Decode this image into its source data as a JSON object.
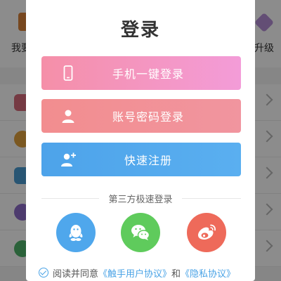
{
  "background": {
    "top_left_label": "我要",
    "top_right_label": "升级"
  },
  "dialog": {
    "title": "登录",
    "buttons": {
      "phone": "手机一键登录",
      "account": "账号密码登录",
      "register": "快速注册"
    },
    "third_party_title": "第三方极速登录",
    "social_icons": [
      "qq-icon",
      "wechat-icon",
      "weibo-icon"
    ],
    "agreement": {
      "prefix": "阅读并同意",
      "user_agreement": "《触手用户协议》",
      "and": "和",
      "privacy_agreement": "《隐私协议》"
    }
  },
  "colors": {
    "phone_button": "#f58fa8",
    "account_button": "#f28d8f",
    "register_button": "#4da3ea",
    "qq": "#4fa7ec",
    "wechat": "#5fcb5c",
    "weibo": "#ee6a5a",
    "link": "#4aa3e6"
  }
}
